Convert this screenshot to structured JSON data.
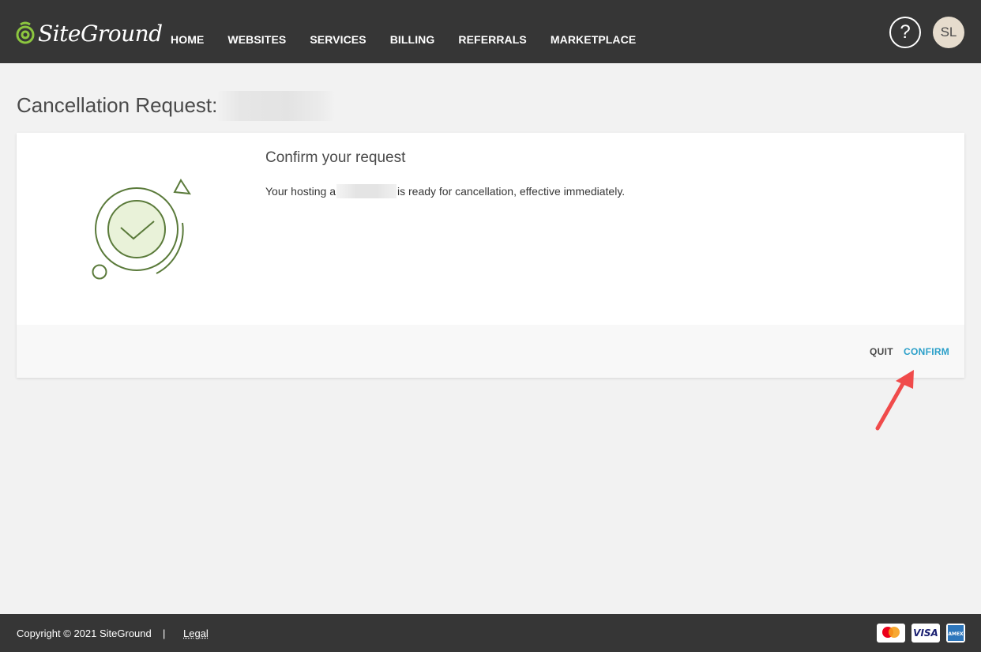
{
  "header": {
    "brand": "SiteGround",
    "nav": [
      "HOME",
      "WEBSITES",
      "SERVICES",
      "BILLING",
      "REFERRALS",
      "MARKETPLACE"
    ],
    "help_label": "?",
    "avatar_initials": "SL"
  },
  "page": {
    "title": "Cancellation Request:"
  },
  "card": {
    "heading": "Confirm your request",
    "text_before": "Your hosting a",
    "text_after": "is ready for cancellation, effective immediately.",
    "quit_label": "QUIT",
    "confirm_label": "CONFIRM"
  },
  "footer": {
    "copyright": "Copyright © 2021 SiteGround",
    "separator": "|",
    "legal": "Legal",
    "payment_icons": [
      "mastercard-icon",
      "visa-icon",
      "amex-icon"
    ],
    "visa_text": "VISA",
    "amex_text": "AMEX"
  },
  "colors": {
    "topbar": "#363636",
    "accent_link": "#2a9fc9",
    "illustration_green": "#5a7a3a",
    "arrow_red": "#f04b4b"
  }
}
